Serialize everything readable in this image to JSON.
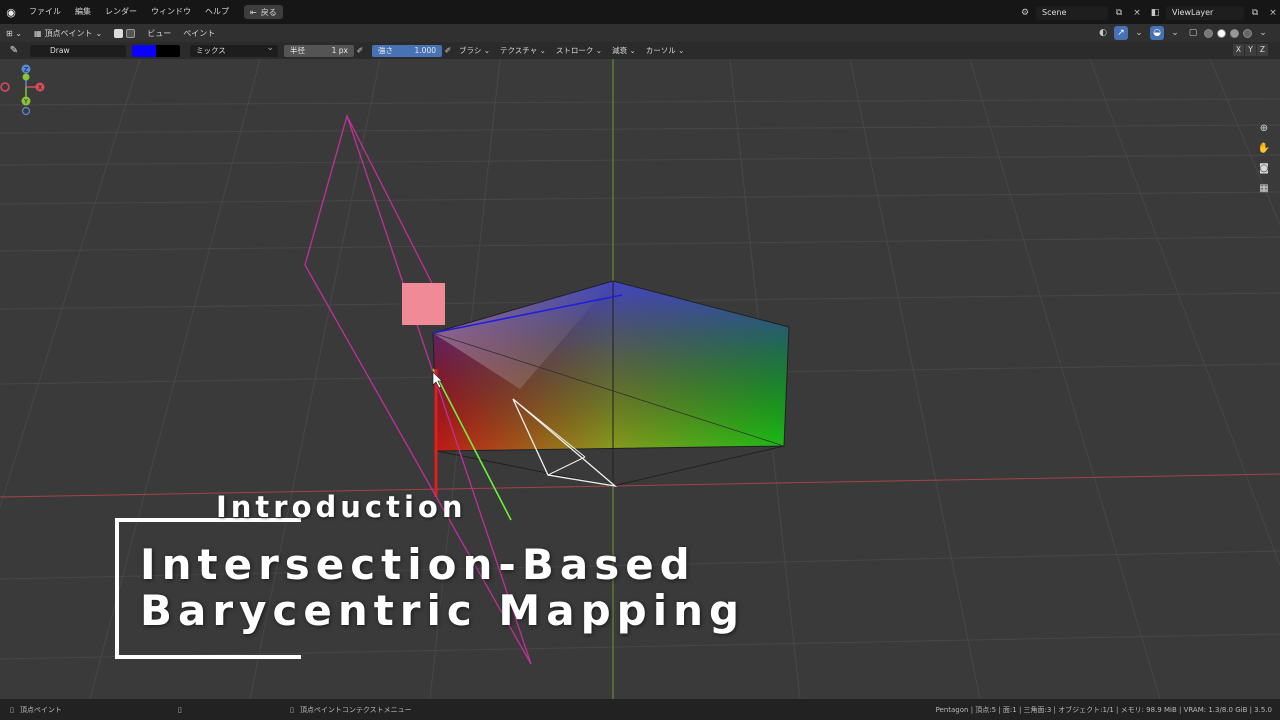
{
  "menubar": {
    "items": [
      "ファイル",
      "編集",
      "レンダー",
      "ウィンドウ",
      "ヘルプ"
    ],
    "back_label": "戻る",
    "scene": "Scene",
    "view_layer": "ViewLayer"
  },
  "header": {
    "mode": "頂点ペイント",
    "menus": [
      "ビュー",
      "ペイント"
    ]
  },
  "tool_settings": {
    "brush_name": "Draw",
    "primary_color": "#0a00ff",
    "secondary_color": "#000000",
    "blend_mode": "ミックス",
    "radius_label": "半径",
    "radius_value": "1 px",
    "strength_label": "強さ",
    "strength_value": "1.000",
    "menus": [
      "ブラシ",
      "テクスチャ",
      "ストローク",
      "減衰",
      "カーソル"
    ],
    "axes": [
      "X",
      "Y",
      "Z"
    ]
  },
  "gizmo": {
    "x": "X",
    "y": "Y",
    "z": "Z"
  },
  "overlay": {
    "subtitle": "Introduction",
    "title_line1": "Intersection-Based",
    "title_line2": "Barycentric Mapping"
  },
  "statusbar": {
    "left": "頂点ペイント",
    "middle": "頂点ペイントコンテクストメニュー",
    "right": "Pentagon | 頂点:5 | 面:1 | 三角面:3 | オブジェクト:1/1 | メモリ: 98.9 MiB | VRAM: 1.3/8.0 GiB | 3.5.0"
  },
  "colors": {
    "accent_blue": "#4772b3",
    "triangle_outline": "#c0309a",
    "marker_pink": "#f08a96"
  }
}
